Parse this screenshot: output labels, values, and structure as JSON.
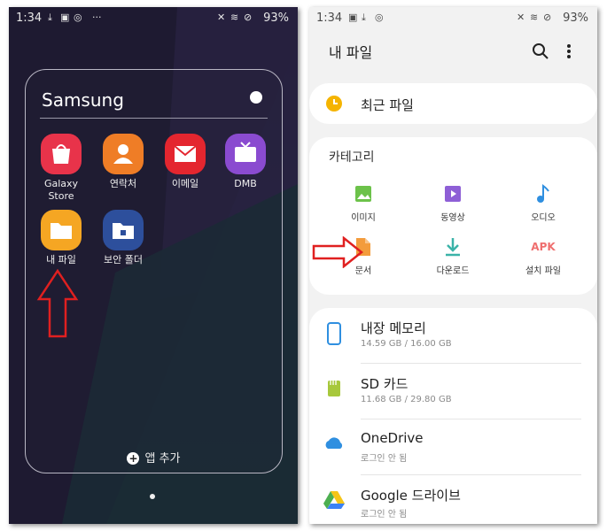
{
  "left": {
    "status": {
      "time": "1:34",
      "battery": "93%"
    },
    "folder": {
      "title": "Samsung",
      "apps": [
        {
          "label": "Galaxy\nStore",
          "icon": "galaxy-store-icon",
          "color": "#e8334a"
        },
        {
          "label": "연락처",
          "icon": "contacts-icon",
          "color": "#ef7d26"
        },
        {
          "label": "이메일",
          "icon": "email-icon",
          "color": "#e4262f"
        },
        {
          "label": "DMB",
          "icon": "dmb-tv-icon",
          "color": "#8a4bd0"
        },
        {
          "label": "내 파일",
          "icon": "my-files-icon",
          "color": "#f5a623"
        },
        {
          "label": "보안 폴더",
          "icon": "secure-folder-icon",
          "color": "#2d4f9c"
        }
      ],
      "add_label": "앱 추가"
    }
  },
  "right": {
    "status": {
      "time": "1:34",
      "battery": "93%"
    },
    "title": "내 파일",
    "recent_label": "최근 파일",
    "category_title": "카테고리",
    "categories": [
      {
        "label": "이미지",
        "icon": "image-icon",
        "color": "#6cc24a"
      },
      {
        "label": "동영상",
        "icon": "video-icon",
        "color": "#8e5fd6"
      },
      {
        "label": "오디오",
        "icon": "audio-icon",
        "color": "#2f8fe0"
      },
      {
        "label": "문서",
        "icon": "document-icon",
        "color": "#f39c3c"
      },
      {
        "label": "다운로드",
        "icon": "download-icon",
        "color": "#3bb3a8"
      },
      {
        "label": "설치 파일",
        "icon": "apk-icon",
        "color": "#ef6f6f",
        "icon_text": "APK"
      }
    ],
    "storage": [
      {
        "name": "내장 메모리",
        "sub": "14.59 GB / 16.00 GB",
        "icon": "phone-icon",
        "color": "#2f8fe0"
      },
      {
        "name": "SD 카드",
        "sub": "11.68 GB / 29.80 GB",
        "icon": "sd-card-icon",
        "color": "#a7c83c"
      },
      {
        "name": "OneDrive",
        "sub": "로그인 안 됨",
        "icon": "cloud-icon",
        "color": "#2f8fe0"
      },
      {
        "name": "Google 드라이브",
        "sub": "로그인 안 됨",
        "icon": "google-drive-icon",
        "color": "#4caf50"
      }
    ]
  },
  "colors": {
    "arrow": "#e02020",
    "accent_clock": "#f5b400"
  }
}
